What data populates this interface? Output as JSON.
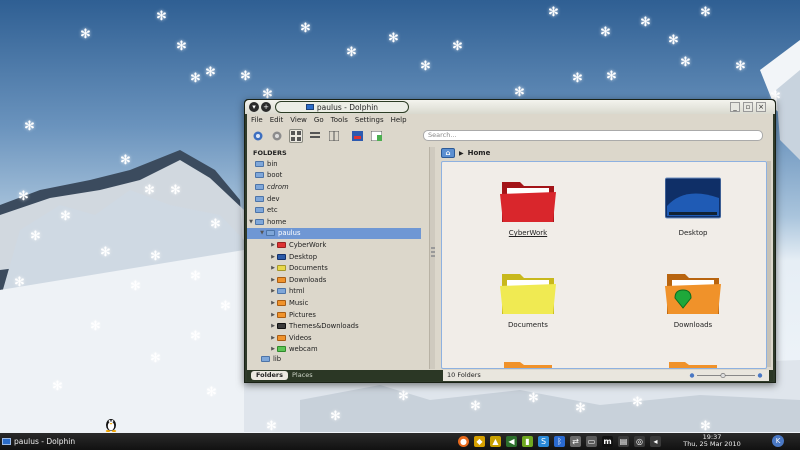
{
  "window": {
    "title": "paulus - Dolphin",
    "menu": [
      "File",
      "Edit",
      "View",
      "Go",
      "Tools",
      "Settings",
      "Help"
    ],
    "search_placeholder": "Search...",
    "folders_header": "FOLDERS",
    "breadcrumb": "Home",
    "status_text": "10 Folders"
  },
  "tree": [
    {
      "label": "bin",
      "indent": 1,
      "color": "blu-l"
    },
    {
      "label": "boot",
      "indent": 1,
      "color": "blu-l"
    },
    {
      "label": "cdrom",
      "indent": 1,
      "color": "blu-l",
      "italic": true
    },
    {
      "label": "dev",
      "indent": 1,
      "color": "blu-l"
    },
    {
      "label": "etc",
      "indent": 1,
      "color": "blu-l"
    },
    {
      "label": "home",
      "indent": 1,
      "color": "blu-l",
      "arrow": "open"
    },
    {
      "label": "paulus",
      "indent": 2,
      "color": "blu-l",
      "arrow": "open",
      "selected": true
    },
    {
      "label": "CyberWork",
      "indent": 3,
      "color": "red",
      "arrow": "closed"
    },
    {
      "label": "Desktop",
      "indent": 3,
      "color": "blu",
      "arrow": "closed"
    },
    {
      "label": "Documents",
      "indent": 3,
      "color": "yel",
      "arrow": "closed"
    },
    {
      "label": "Downloads",
      "indent": 3,
      "color": "ora",
      "arrow": "closed"
    },
    {
      "label": "html",
      "indent": 3,
      "color": "blu-l",
      "arrow": "closed"
    },
    {
      "label": "Music",
      "indent": 3,
      "color": "ora",
      "arrow": "closed"
    },
    {
      "label": "Pictures",
      "indent": 3,
      "color": "ora",
      "arrow": "closed"
    },
    {
      "label": "Themes&Downloads",
      "indent": 3,
      "color": "dk",
      "arrow": "closed"
    },
    {
      "label": "Videos",
      "indent": 3,
      "color": "ora",
      "arrow": "closed"
    },
    {
      "label": "webcam",
      "indent": 3,
      "color": "grn",
      "arrow": "closed"
    }
  ],
  "tree_bottom": "lib",
  "items": [
    {
      "label": "CyberWork",
      "color": "#d9262c",
      "dark": "#a31418",
      "underline": true
    },
    {
      "label": "Desktop",
      "color": "desktop"
    },
    {
      "label": "Documents",
      "color": "#f0ea52",
      "dark": "#c8b81c"
    },
    {
      "label": "Downloads",
      "color": "#f0922a",
      "dark": "#b8640f",
      "badge": true
    }
  ],
  "panel_tabs": {
    "folders": "Folders",
    "places": "Places"
  },
  "taskbar": {
    "task_label": "paulus - Dolphin",
    "time": "19:37",
    "date": "Thu, 25 Mar 2010"
  },
  "colors": {
    "accent": "#6f97d4",
    "titlebar": "#2f3a2a",
    "desktop_sky": "#2f5f93"
  }
}
